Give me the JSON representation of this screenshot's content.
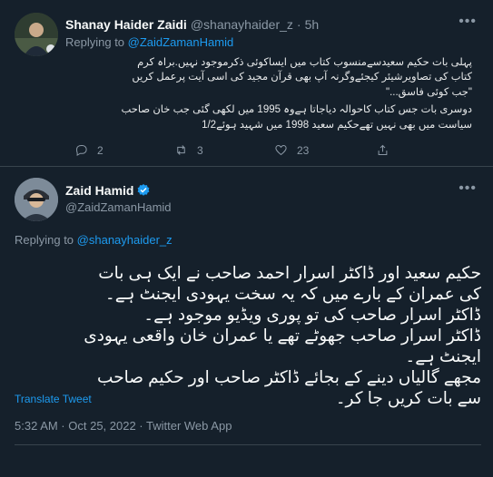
{
  "reply_tweet": {
    "display_name": "Shanay Haider Zaidi",
    "handle": "@shanayhaider_z",
    "separator": "·",
    "time": "5h",
    "replying_prefix": "Replying to",
    "replying_to": "@ZaidZamanHamid",
    "lines": [
      "پہلی بات حکیم سعیدسےمنسوب کتاب میں ایساکوئی ذکرموجود نہیں.براہ کرم",
      "کتاب کی تصاویرشیئر کیجئےوگرنہ آپ بھی قرآن مجید کی اسی آیت پرعمل کریں",
      "\"جب کوئی فاسق...\"",
      "دوسری بات جس کتاب کاحوالہ دیاجاتا ہےوہ 1995 میں لکھی گئی جب خان صاحب",
      "سیاست میں بھی نہیں تھےحکیم سعید 1998 میں شہید ہوئے1/2"
    ],
    "reply_count": "2",
    "retweet_count": "3",
    "like_count": "23"
  },
  "main_tweet": {
    "display_name": "Zaid Hamid",
    "handle": "@ZaidZamanHamid",
    "replying_prefix": "Replying to",
    "replying_to": "@shanayhaider_z",
    "lines": [
      "حکیم سعید اور ڈاکٹر اسرار احمد صاحب نے ایک ہی بات",
      "کی عمران کے بارے میں کہ یہ سخت یہودی ایجنٹ ہے۔",
      "ڈاکٹر اسرار صاحب کی تو پوری ویڈیو موجود ہے۔",
      "ڈاکٹر اسرار صاحب جھوٹے تھے یا عمران خان واقعی یہودی",
      "ایجنٹ ہے۔",
      "مجھے گالیاں دینے کے بجائے ڈاکٹر صاحب اور حکیم صاحب",
      "سے بات کریں جا کر۔"
    ],
    "translate_label": "Translate Tweet",
    "timestamp": "5:32 AM · Oct 25, 2022 · Twitter Web App"
  },
  "colors": {
    "background": "#15202b",
    "accent": "#1d9bf0",
    "muted": "#8b98a5",
    "divider": "#38444d"
  }
}
